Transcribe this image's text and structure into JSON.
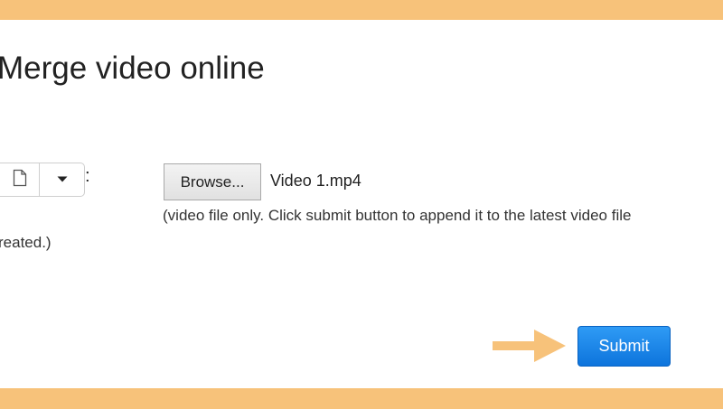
{
  "page": {
    "title": "Merge video online"
  },
  "form": {
    "colon": ":",
    "browse_label": "Browse...",
    "selected_file": "Video 1.mp4",
    "help_text_line1": "(video file only. Click submit button to append it to the latest video file",
    "help_text_line2": "reated.)",
    "submit_label": "Submit"
  },
  "icons": {
    "file": "file-icon",
    "dropdown": "caret-down-icon",
    "pointer": "arrow-right-icon"
  },
  "colors": {
    "frame": "#f7c27a",
    "submit": "#1a82e8",
    "arrow": "#f7c27a"
  }
}
